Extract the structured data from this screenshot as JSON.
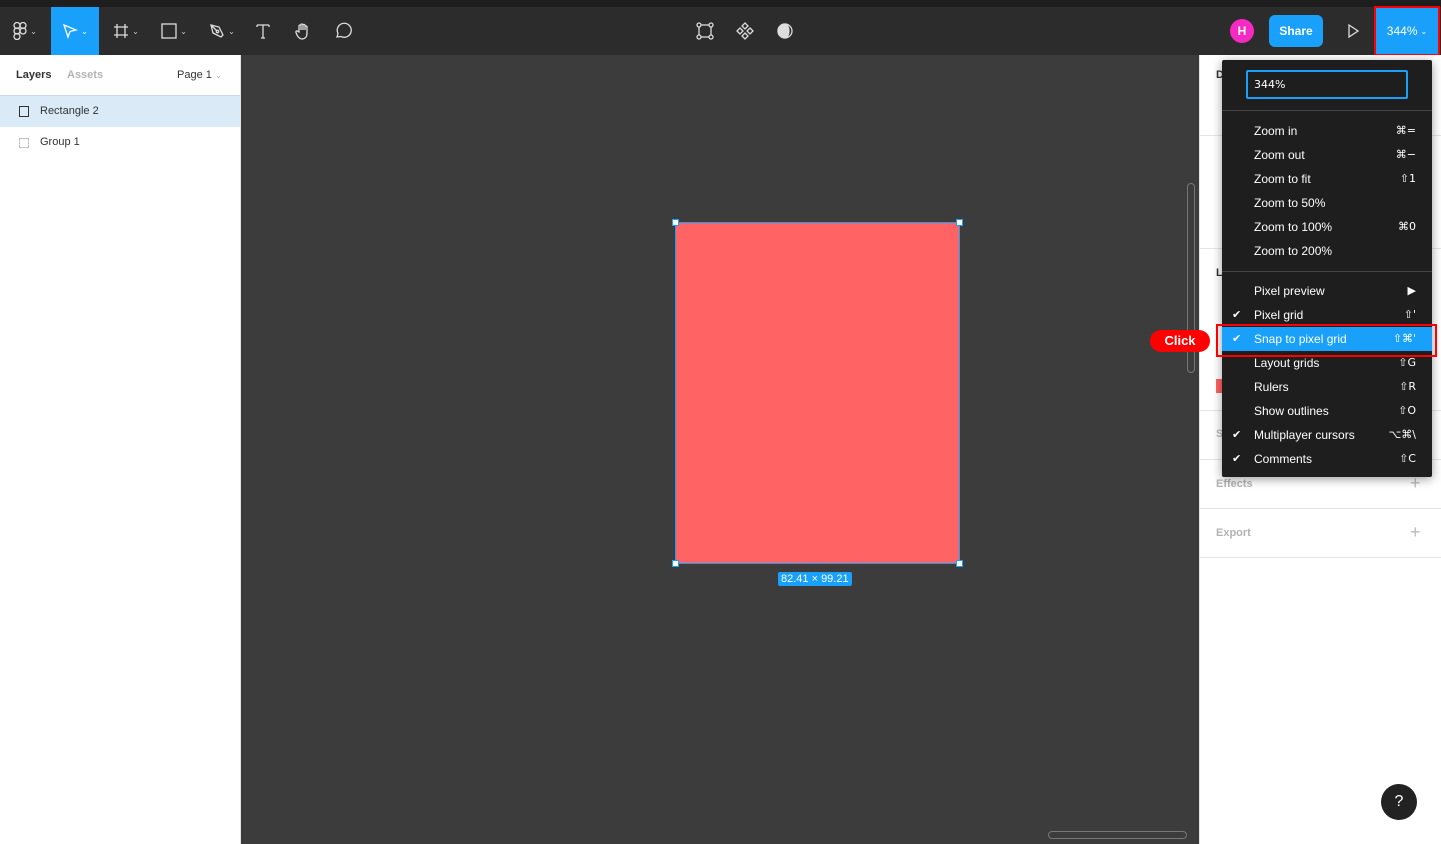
{
  "toolbar": {
    "zoom_label": "344%",
    "share_label": "Share",
    "avatar_initial": "H",
    "accent": "#18a0fb"
  },
  "left_panel": {
    "tabs": [
      "Layers",
      "Assets"
    ],
    "page": "Page 1",
    "layers": [
      {
        "name": "Rectangle 2",
        "selected": true,
        "icon": "rectangle-icon"
      },
      {
        "name": "Group 1",
        "selected": false,
        "icon": "group-icon"
      }
    ]
  },
  "canvas": {
    "rect_fill": "#ff6363",
    "size_label": "82.41 × 99.21"
  },
  "right_panel": {
    "partial_letters": [
      "D",
      "L",
      "S"
    ],
    "effects": "Effects",
    "export": "Export"
  },
  "zoom_menu": {
    "input_value": "344%",
    "group1": [
      {
        "label": "Zoom in",
        "shortcut": "⌘="
      },
      {
        "label": "Zoom out",
        "shortcut": "⌘−"
      },
      {
        "label": "Zoom to fit",
        "shortcut": "⇧1"
      },
      {
        "label": "Zoom to 50%",
        "shortcut": ""
      },
      {
        "label": "Zoom to 100%",
        "shortcut": "⌘0"
      },
      {
        "label": "Zoom to 200%",
        "shortcut": ""
      }
    ],
    "group2": [
      {
        "label": "Pixel preview",
        "shortcut": "▶",
        "checked": false
      },
      {
        "label": "Pixel grid",
        "shortcut": "⇧'",
        "checked": true
      },
      {
        "label": "Snap to pixel grid",
        "shortcut": "⇧⌘'",
        "checked": true,
        "highlighted": true
      },
      {
        "label": "Layout grids",
        "shortcut": "⇧G",
        "checked": false
      },
      {
        "label": "Rulers",
        "shortcut": "⇧R",
        "checked": false
      },
      {
        "label": "Show outlines",
        "shortcut": "⇧O",
        "checked": false
      },
      {
        "label": "Multiplayer cursors",
        "shortcut": "⌥⌘\\",
        "checked": true
      },
      {
        "label": "Comments",
        "shortcut": "⇧C",
        "checked": true
      }
    ]
  },
  "annotation": {
    "click_label": "Click"
  },
  "help": "?"
}
